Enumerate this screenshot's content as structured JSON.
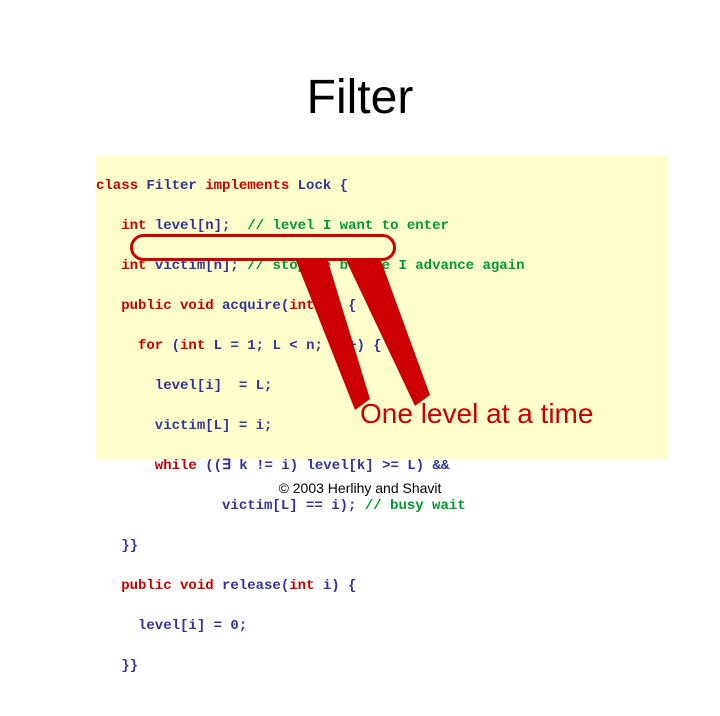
{
  "title": "Filter",
  "code": {
    "l01a": "class",
    "l01b": " Filter ",
    "l01c": "implements",
    "l01d": " Lock {",
    "l02a": "   int",
    "l02b": " level[n];  ",
    "l02c": "// level I want to enter",
    "l03a": "   int",
    "l03b": " victim[n]; ",
    "l03c": "// stop me before I advance again",
    "l04a": "   public void",
    "l04b": " acquire(",
    "l04c": "int",
    "l04d": " i) {",
    "l05a": "     for",
    "l05b": " (",
    "l05c": "int",
    "l05d": " L = 1; L < n; L++) {",
    "l06": "       level[i]  = L;",
    "l07": "       victim[L] = i;",
    "l08a": "       while",
    "l08b": " ((∃ k != i) level[k] >= L) &&",
    "l09a": "               victim[L] == i); ",
    "l09c": "// busy wait",
    "l10": "   }}",
    "l11a": "   public void",
    "l11b": " release(",
    "l11c": "int",
    "l11d": " i) {",
    "l12": "     level[i] = 0;",
    "l13": "   }}"
  },
  "annotation": "One level at a time",
  "footer": "© 2003 Herlihy and Shavit"
}
